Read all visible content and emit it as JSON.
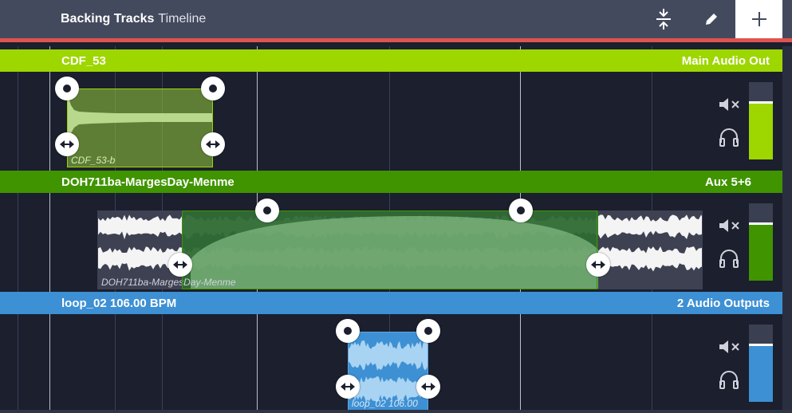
{
  "header": {
    "title": "Backing Tracks",
    "subtitle": "Timeline"
  },
  "colors": {
    "track1": "#9ed600",
    "track2": "#3f9400",
    "track3": "#3d90d3",
    "red_bar": "#e0534f"
  },
  "tracks": [
    {
      "name": "CDF_53",
      "output": "Main Audio Out",
      "clip_label": "CDF_53-b",
      "meter_level": 0.92
    },
    {
      "name": "DOH711ba-MargesDay-Menme",
      "output": "Aux 5+6",
      "clip_label": "DOH711ba-MargesDay-Menme",
      "meter_level": 0.86
    },
    {
      "name": "loop_02 106.00 BPM",
      "output": "2 Audio Outputs",
      "clip_label": "loop_02 106.00",
      "meter_level": 0.92
    }
  ],
  "icons": {
    "snap": "collapse-vertical-icon",
    "edit": "pencil-icon",
    "add": "plus-icon",
    "mute": "speaker-mute-icon",
    "headphones": "headphones-icon"
  }
}
